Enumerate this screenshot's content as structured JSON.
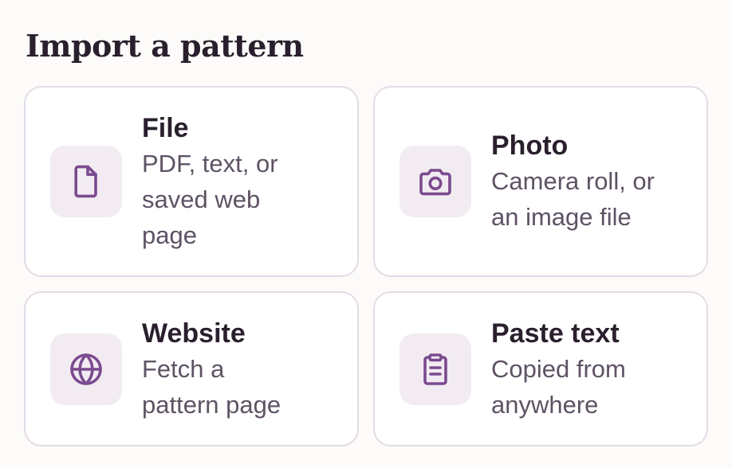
{
  "page": {
    "title": "Import a pattern"
  },
  "options": [
    {
      "title": "File",
      "description": "PDF, text, or\nsaved web\npage",
      "icon": "file-icon"
    },
    {
      "title": "Photo",
      "description": "Camera roll, or\nan image file",
      "icon": "camera-icon"
    },
    {
      "title": "Website",
      "description": "Fetch a\npattern page",
      "icon": "globe-icon"
    },
    {
      "title": "Paste text",
      "description": "Copied from\nanywhere",
      "icon": "clipboard-icon"
    }
  ],
  "colors": {
    "icon": "#7b4a8f",
    "icon_tile": "#f2ecf2",
    "card_border": "#e4dbe8",
    "title_text": "#2a1f2d",
    "description_text": "#5e5364",
    "background": "#fcfbf9"
  }
}
